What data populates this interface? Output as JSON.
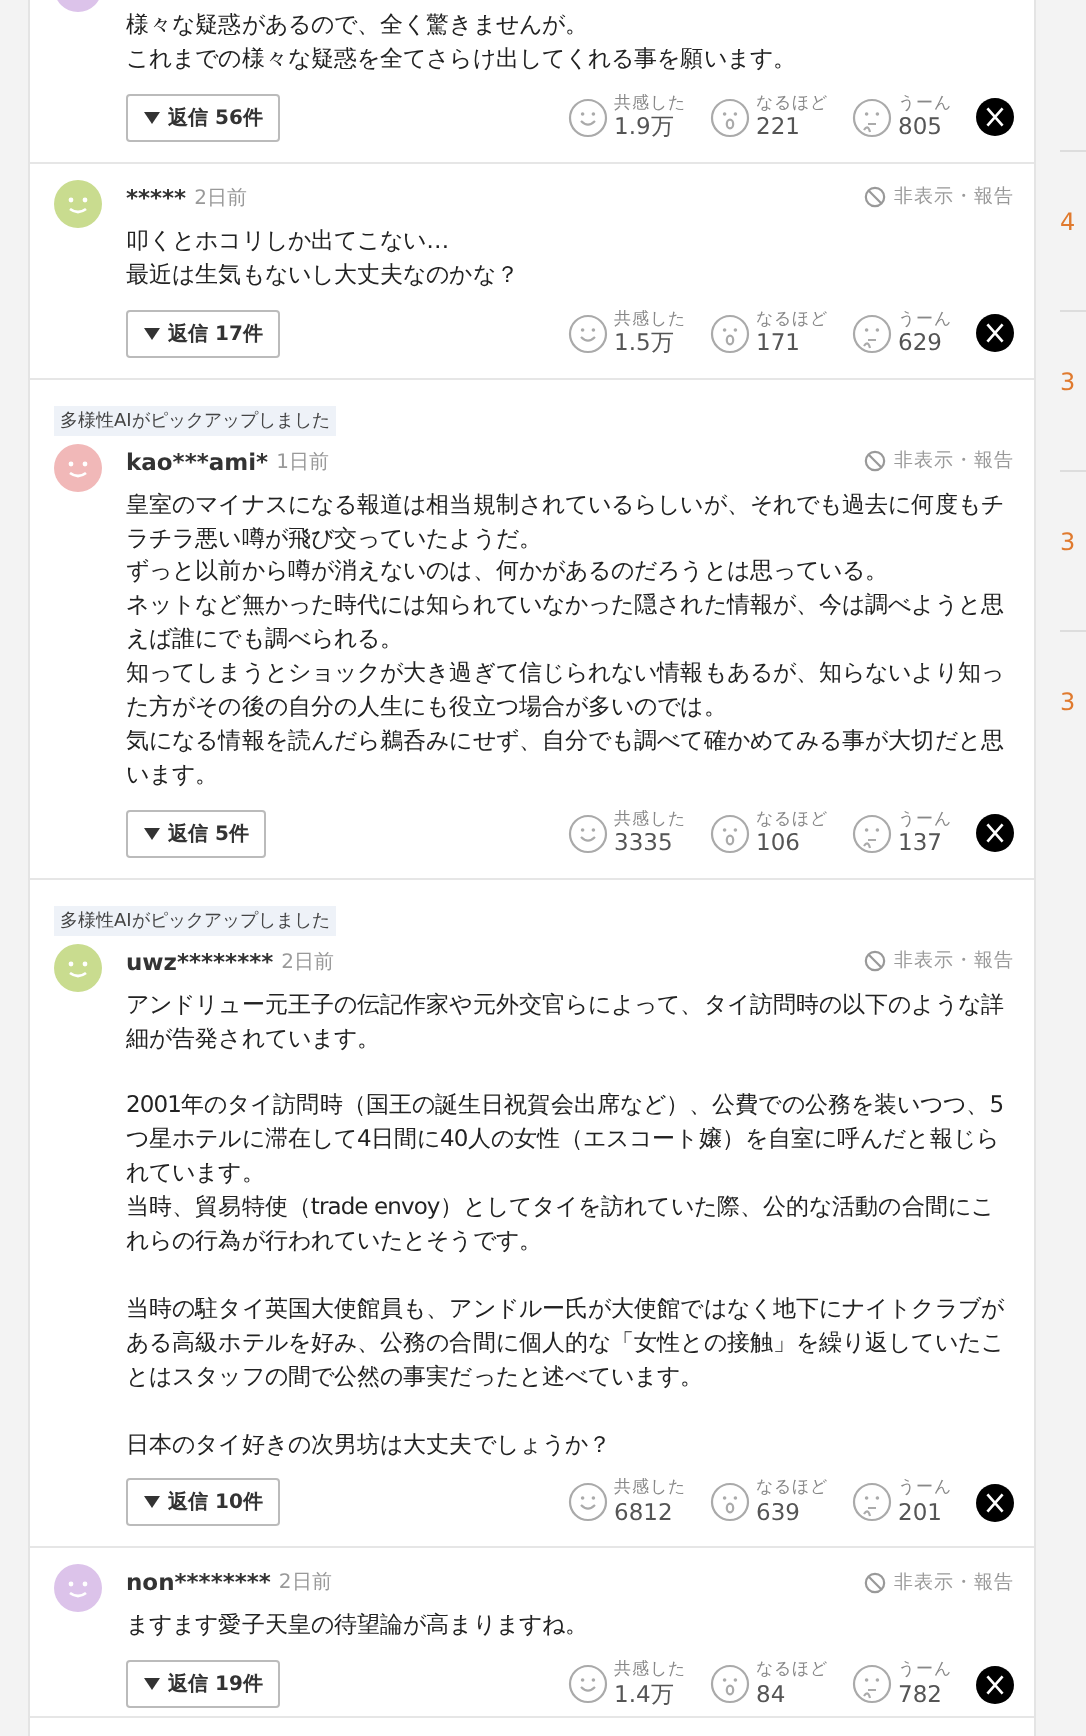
{
  "comments": [
    {
      "color": "#dcc3ea",
      "paragraphs": [
        [
          "様々な疑惑があるので、全く驚きませんが。",
          "これまでの様々な疑惑を全てさらけ出してくれる事を願います。"
        ]
      ],
      "replies": "返信 56件",
      "reactions": [
        {
          "label": "共感した",
          "count": "1.9万"
        },
        {
          "label": "なるほど",
          "count": "221"
        },
        {
          "label": "うーん",
          "count": "805"
        }
      ]
    },
    {
      "author": "*****",
      "time": "2日前",
      "color": "#c9dc8f",
      "hide_report": "非表示・報告",
      "paragraphs": [
        [
          "叩くとホコリしか出てこない…",
          "最近は生気もないし大丈夫なのかな？"
        ]
      ],
      "replies": "返信 17件",
      "reactions": [
        {
          "label": "共感した",
          "count": "1.5万"
        },
        {
          "label": "なるほど",
          "count": "171"
        },
        {
          "label": "うーん",
          "count": "629"
        }
      ]
    },
    {
      "badge": "多様性AIがピックアップしました",
      "author": "kao***ami*",
      "time": "1日前",
      "color": "#f1b8b8",
      "hide_report": "非表示・報告",
      "paragraphs": [
        [
          "皇室のマイナスになる報道は相当規制されているらしいが、それでも過去に何度もチラチラ悪い噂が飛び交っていたようだ。",
          "ずっと以前から噂が消えないのは、何かがあるのだろうとは思っている。",
          "ネットなど無かった時代には知られていなかった隠された情報が、今は調べようと思えば誰にでも調べられる。",
          "知ってしまうとショックが大き過ぎて信じられない情報もあるが、知らないより知った方がその後の自分の人生にも役立つ場合が多いのでは。",
          "気になる情報を読んだら鵜呑みにせず、自分でも調べて確かめてみる事が大切だと思います。"
        ]
      ],
      "replies": "返信 5件",
      "reactions": [
        {
          "label": "共感した",
          "count": "3335"
        },
        {
          "label": "なるほど",
          "count": "106"
        },
        {
          "label": "うーん",
          "count": "137"
        }
      ]
    },
    {
      "badge": "多様性AIがピックアップしました",
      "author": "uwz********",
      "time": "2日前",
      "color": "#c9dc8f",
      "hide_report": "非表示・報告",
      "paragraphs": [
        [
          "アンドリュー元王子の伝記作家や元外交官らによって、タイ訪問時の以下のような詳細が告発されています。"
        ],
        [
          "2001年のタイ訪問時（国王の誕生日祝賀会出席など）、公費での公務を装いつつ、5つ星ホテルに滞在して4日間に40人の女性（エスコート嬢）を自室に呼んだと報じられています。",
          "当時、貿易特使（trade envoy）としてタイを訪れていた際、公的な活動の合間にこれらの行為が行われていたとそうです。"
        ],
        [
          "当時の駐タイ英国大使館員も、アンドルー氏が大使館ではなく地下にナイトクラブがある高級ホテルを好み、公務の合間に個人的な「女性との接触」を繰り返していたことはスタッフの間で公然の事実だったと述べています。"
        ],
        [
          "日本のタイ好きの次男坊は大丈夫でしょうか？"
        ]
      ],
      "replies": "返信 10件",
      "reactions": [
        {
          "label": "共感した",
          "count": "6812"
        },
        {
          "label": "なるほど",
          "count": "639"
        },
        {
          "label": "うーん",
          "count": "201"
        }
      ]
    },
    {
      "author": "non********",
      "time": "2日前",
      "color": "#dcc3ea",
      "hide_report": "非表示・報告",
      "paragraphs": [
        [
          "ますます愛子天皇の待望論が高まりますね。"
        ]
      ],
      "replies": "返信 19件",
      "reactions": [
        {
          "label": "共感した",
          "count": "1.4万"
        },
        {
          "label": "なるほど",
          "count": "84"
        },
        {
          "label": "うーん",
          "count": "782"
        }
      ]
    }
  ],
  "sidebar": {
    "items": [
      {
        "count": "4"
      },
      {
        "count": "3"
      },
      {
        "count": "3"
      },
      {
        "count": "3"
      }
    ]
  }
}
